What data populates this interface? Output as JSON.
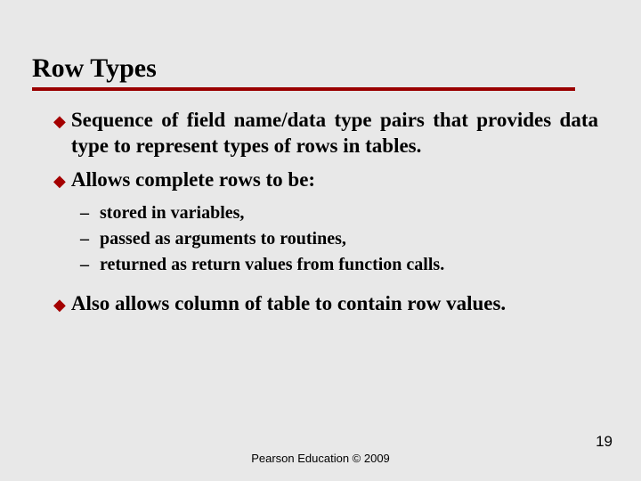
{
  "title": "Row Types",
  "bullets": [
    {
      "lead": "Sequence",
      "rest": " of field name/data type pairs that provides data type to represent types of rows in tables."
    },
    {
      "lead": "Allows",
      "rest": " complete rows to be:"
    }
  ],
  "sub_items": [
    "stored in variables,",
    "passed as arguments to routines,",
    "returned as return values from function calls."
  ],
  "bullet_after": {
    "lead": "Also",
    "rest": " allows column of table to contain row values."
  },
  "footer": "Pearson Education © 2009",
  "page_number": "19"
}
